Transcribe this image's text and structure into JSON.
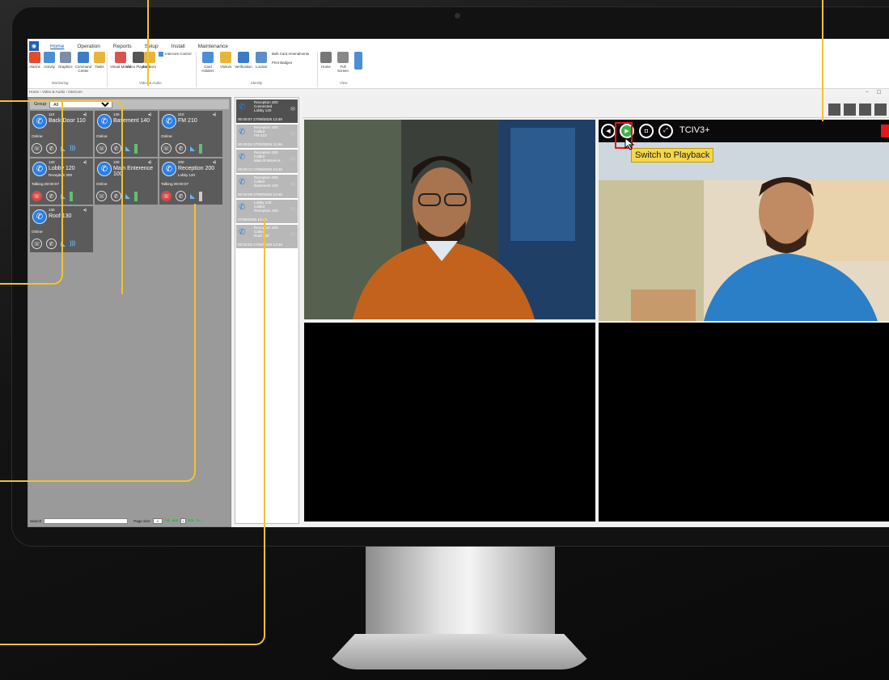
{
  "menu": {
    "items": [
      "Home",
      "Operation",
      "Reports",
      "Setup",
      "Install",
      "Maintenance"
    ],
    "active": "Home"
  },
  "ribbon": {
    "monitoring": {
      "label": "Monitoring",
      "buttons": [
        "Alarms",
        "Activity",
        "Graphics",
        "Command Center",
        "Tasks"
      ]
    },
    "video_audio": {
      "label": "Video & Audio",
      "buttons": [
        "Virtual Matrix",
        "Video Playback",
        "Intercom"
      ],
      "extra": "Intercom Control"
    },
    "identity": {
      "label": "Identity",
      "buttons": [
        "Card Holders",
        "Visitors",
        "Verification",
        "Locator"
      ],
      "extra1": "Bulk Card Amendments",
      "extra2": "Print Badges"
    },
    "view": {
      "label": "View",
      "buttons": [
        "Home",
        "Full Screen"
      ]
    }
  },
  "breadcrumb": "Home › Video & Audio › Intercom",
  "group": {
    "label": "Group",
    "value": "All"
  },
  "tiles": [
    {
      "num": "110",
      "name": "Back Door 110",
      "status": "Online",
      "sub": "",
      "extra": "wave"
    },
    {
      "num": "140",
      "name": "Basement 140",
      "status": "Online",
      "sub": "",
      "extra": "door"
    },
    {
      "num": "210",
      "name": "FM 210",
      "status": "Online",
      "sub": "",
      "extra": "door"
    },
    {
      "num": "120",
      "name": "Lobby 120",
      "status": "Talking  00:00:07",
      "sub": "Reception 200",
      "extra": "door"
    },
    {
      "num": "100",
      "name": "Main Enterence 100",
      "status": "Online",
      "sub": "",
      "extra": "door"
    },
    {
      "num": "200",
      "name": "Reception 200",
      "status": "Talking  00:00:07",
      "sub": "Lobby 120",
      "extra": "doorwhite"
    },
    {
      "num": "130",
      "name": "Roof 130",
      "status": "Online",
      "sub": "",
      "extra": "wave"
    }
  ],
  "pager": {
    "search_label": "Search",
    "page_size_label": "Page Size",
    "page_size": "9",
    "page": "1"
  },
  "call_log": [
    {
      "l1": "Reception 200",
      "l2": "Connected",
      "l3": "Lobby 120",
      "time": "00:00:07 27/08/2025 13:46"
    },
    {
      "l1": "Reception 200",
      "l2": "Called",
      "l3": "FM 210",
      "time": "00:00:02 27/08/2025 13:46"
    },
    {
      "l1": "Reception 200",
      "l2": "Called",
      "l3": "Main Enterence...",
      "time": "00:00:12 27/08/2025 13:46"
    },
    {
      "l1": "Reception 200",
      "l2": "Called",
      "l3": "Basement 140",
      "time": "00:00:08 27/08/2025 13:46"
    },
    {
      "l1": "Lobby 120",
      "l2": "Called",
      "l3": "Reception 200",
      "time": "27/08/2025 13:46"
    },
    {
      "l1": "Reception 200",
      "l2": "Called",
      "l3": "Roof 130",
      "time": "00:00:02 27/08/2025 13:46"
    }
  ],
  "video": {
    "device_name": "TCIV3+",
    "tooltip": "Switch to Playback"
  },
  "colors": {
    "accent": "#1e60b4",
    "callout": "#f1c232",
    "tile_bg": "#5b5b5b",
    "phone_blue": "#2a7ee6"
  }
}
